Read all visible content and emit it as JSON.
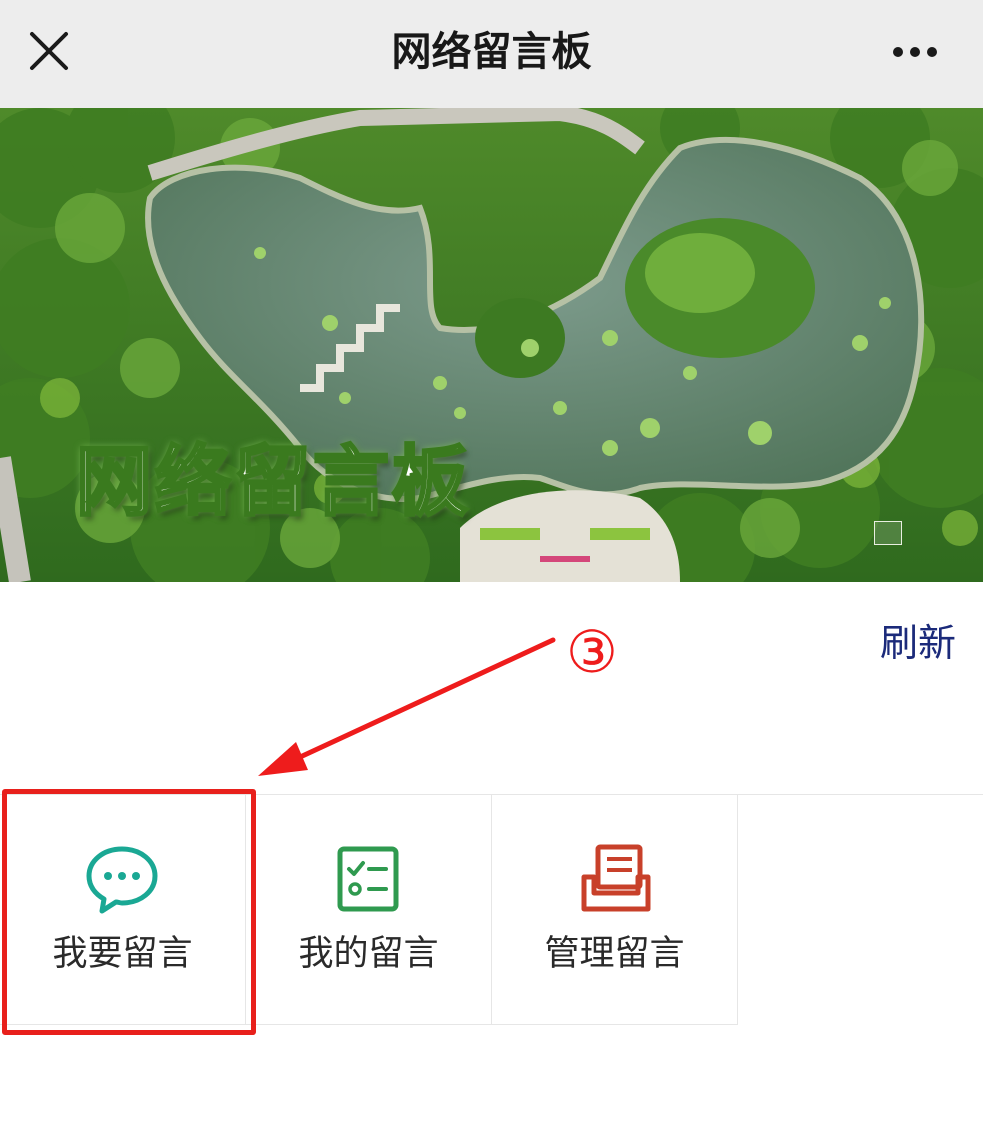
{
  "nav": {
    "title": "网络留言板",
    "close_icon": "close-icon",
    "more_icon": "more-dots-icon"
  },
  "banner": {
    "caption": "网络留言板",
    "image": "aerial-park-pond-photo",
    "stamp_icon": "seal-stamp-icon"
  },
  "refresh_label": "刷新",
  "annotation": {
    "step": "③",
    "color": "#ee1c1c"
  },
  "grid": {
    "items": [
      {
        "label": "我要留言",
        "icon": "chat-bubble-icon",
        "color": "#1aa894",
        "highlighted": true
      },
      {
        "label": "我的留言",
        "icon": "checklist-icon",
        "color": "#2f9a4f",
        "highlighted": false
      },
      {
        "label": "管理留言",
        "icon": "inbox-tray-icon",
        "color": "#c8402a",
        "highlighted": false
      }
    ]
  }
}
